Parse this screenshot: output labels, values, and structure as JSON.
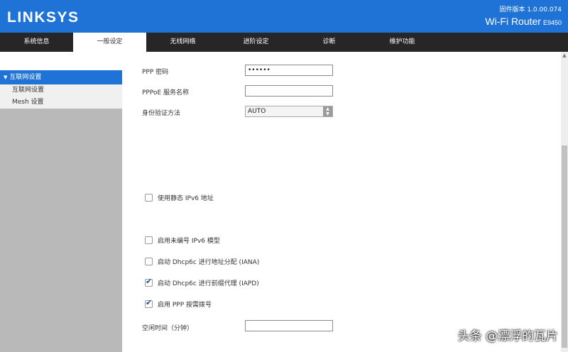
{
  "header": {
    "logo": "LINKSYS",
    "firmware_label": "固件版本 1.0.00.074",
    "model_name": "Wi-Fi Router",
    "model_code": "E9450",
    "bg_color": "#1f73d6"
  },
  "nav": {
    "tabs": [
      {
        "label": "系统信息"
      },
      {
        "label": "一般设定",
        "active": true
      },
      {
        "label": "无线网络"
      },
      {
        "label": "进阶设定"
      },
      {
        "label": "诊断"
      },
      {
        "label": "维护功能"
      }
    ]
  },
  "sidebar": {
    "section": "互联网设置",
    "items": [
      {
        "label": "互联网设置"
      },
      {
        "label": "Mesh 设置"
      }
    ]
  },
  "form": {
    "ppp_password_label": "PPP 密码",
    "ppp_password_value": "••••••",
    "pppoe_service_label": "PPPoE 服务名称",
    "pppoe_service_value": "",
    "auth_method_label": "身份验证方法",
    "auth_method_value": "AUTO",
    "static_ipv6_label": "使用静态 IPv6 地址",
    "static_ipv6_checked": false,
    "unnumbered_ipv6_label": "启用未编号 IPv6 模型",
    "unnumbered_ipv6_checked": false,
    "dhcp6c_iana_label": "启动 Dhcp6c 进行地址分配 (IANA)",
    "dhcp6c_iana_checked": false,
    "dhcp6c_iapd_label": "启动 Dhcp6c 进行前缀代理 (IAPD)",
    "dhcp6c_iapd_checked": true,
    "ppp_on_demand_label": "启用 PPP 按需拨号",
    "ppp_on_demand_checked": true,
    "idle_time_label": "空闲时间（分钟）",
    "idle_time_value": ""
  },
  "watermark": "头条 @漂浮的瓦片"
}
